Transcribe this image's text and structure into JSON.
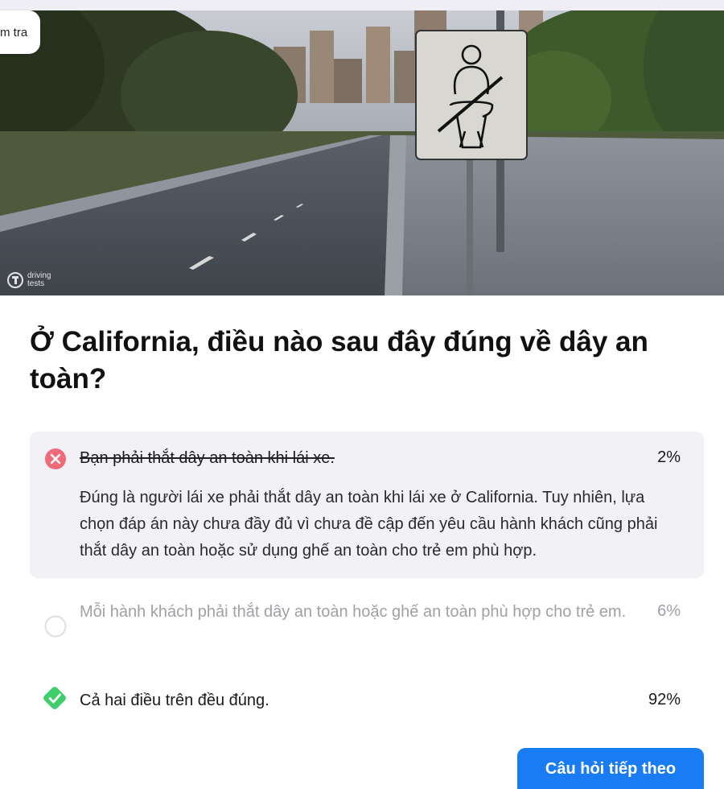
{
  "header": {
    "pill_label": "m tra",
    "watermark_text": "driving tests"
  },
  "hero": {
    "description_icon": "seatbelt-sign"
  },
  "question": {
    "text": "Ở California, điều nào sau đây đúng về dây an toàn?"
  },
  "options": [
    {
      "label": "Bạn phải thắt dây an toàn khi lái xe.",
      "percent": "2%",
      "state": "wrong",
      "icon": "x-circle-icon",
      "explanation": "Đúng là người lái xe phải thắt dây an toàn khi lái xe ở California. Tuy nhiên, lựa chọn đáp án này chưa đầy đủ vì chưa đề cập đến yêu cầu hành khách cũng phải thắt dây an toàn hoặc sử dụng ghế an toàn cho trẻ em phù hợp."
    },
    {
      "label": "Mỗi hành khách phải thắt dây an toàn hoặc ghế an toàn phù hợp cho trẻ em.",
      "percent": "6%",
      "state": "unselected",
      "icon": "empty-circle-icon"
    },
    {
      "label": "Cả hai điều trên đều đúng.",
      "percent": "92%",
      "state": "correct",
      "icon": "check-diamond-icon"
    }
  ],
  "actions": {
    "next_label": "Câu hỏi tiếp theo"
  },
  "colors": {
    "accent": "#1a7cf4",
    "wrong": "#f06a7a",
    "correct": "#3ecf6a",
    "wrong_bg": "#f1f1f6"
  }
}
